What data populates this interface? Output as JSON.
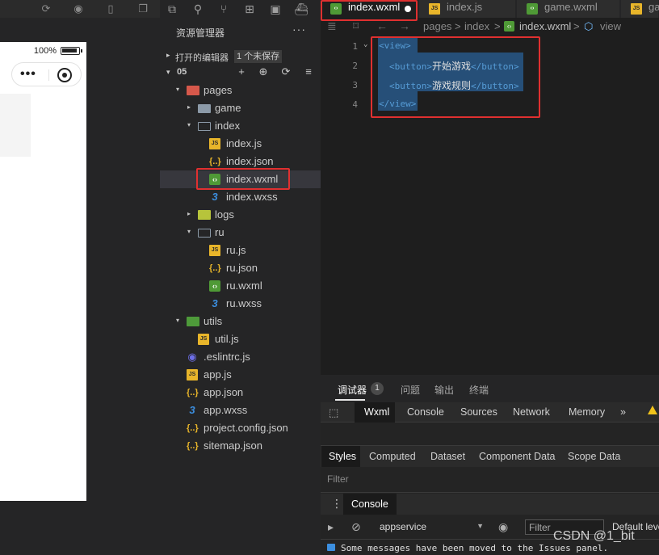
{
  "simulator": {
    "battery_percent": "100%"
  },
  "explorer": {
    "title": "资源管理器",
    "more": "···",
    "open_editors": {
      "label": "打开的编辑器",
      "unsaved_badge": "1 个未保存"
    },
    "project": {
      "name": "05"
    },
    "tree": [
      {
        "name": "pages",
        "kind": "folder-pages",
        "depth": 1,
        "arrow": "▾"
      },
      {
        "name": "game",
        "kind": "folder",
        "depth": 2,
        "arrow": "▸"
      },
      {
        "name": "index",
        "kind": "folder-open",
        "depth": 2,
        "arrow": "▾"
      },
      {
        "name": "index.js",
        "kind": "js",
        "depth": 3
      },
      {
        "name": "index.json",
        "kind": "json",
        "depth": 3
      },
      {
        "name": "index.wxml",
        "kind": "wxml",
        "depth": 3,
        "selected": true
      },
      {
        "name": "index.wxss",
        "kind": "wxss",
        "depth": 3
      },
      {
        "name": "logs",
        "kind": "folder-logs",
        "depth": 2,
        "arrow": "▸"
      },
      {
        "name": "ru",
        "kind": "folder-open",
        "depth": 2,
        "arrow": "▾"
      },
      {
        "name": "ru.js",
        "kind": "js",
        "depth": 3
      },
      {
        "name": "ru.json",
        "kind": "json",
        "depth": 3
      },
      {
        "name": "ru.wxml",
        "kind": "wxml",
        "depth": 3
      },
      {
        "name": "ru.wxss",
        "kind": "wxss",
        "depth": 3
      },
      {
        "name": "utils",
        "kind": "folder-utils",
        "depth": 1,
        "arrow": "▾"
      },
      {
        "name": "util.js",
        "kind": "js",
        "depth": 2
      },
      {
        "name": ".eslintrc.js",
        "kind": "eslint",
        "depth": 1
      },
      {
        "name": "app.js",
        "kind": "js",
        "depth": 1
      },
      {
        "name": "app.json",
        "kind": "json",
        "depth": 1
      },
      {
        "name": "app.wxss",
        "kind": "wxss",
        "depth": 1
      },
      {
        "name": "project.config.json",
        "kind": "json",
        "depth": 1
      },
      {
        "name": "sitemap.json",
        "kind": "json",
        "depth": 1
      }
    ]
  },
  "editor": {
    "tabs": [
      {
        "name": "index.wxml",
        "kind": "wxml",
        "active": true,
        "dirty": true
      },
      {
        "name": "index.js",
        "kind": "js"
      },
      {
        "name": "game.wxml",
        "kind": "wxml"
      },
      {
        "name": "gar",
        "kind": "js"
      }
    ],
    "breadcrumbs": {
      "pages": "pages",
      "sep": ">",
      "index": "index",
      "file": "index.wxml",
      "node": "view"
    },
    "lines": [
      {
        "num": "1",
        "open": "<view>",
        "text": "",
        "close": ""
      },
      {
        "num": "2",
        "open": "<button>",
        "text": "开始游戏",
        "close": "</button>"
      },
      {
        "num": "3",
        "open": "<button>",
        "text": "游戏规则",
        "close": "</button>"
      },
      {
        "num": "4",
        "open": "</view>",
        "text": "",
        "close": ""
      }
    ]
  },
  "devtools": {
    "top_tabs": [
      {
        "label": "调试器",
        "active": true,
        "badge": "1"
      },
      {
        "label": "问题"
      },
      {
        "label": "输出"
      },
      {
        "label": "终端"
      }
    ],
    "panel_tabs": [
      {
        "label": "Wxml",
        "active": true
      },
      {
        "label": "Console"
      },
      {
        "label": "Sources"
      },
      {
        "label": "Network"
      },
      {
        "label": "Memory"
      },
      {
        "label": "»"
      }
    ],
    "style_tabs": [
      {
        "label": "Styles",
        "active": true
      },
      {
        "label": "Computed"
      },
      {
        "label": "Dataset"
      },
      {
        "label": "Component Data"
      },
      {
        "label": "Scope Data"
      }
    ],
    "filter_placeholder": "Filter",
    "console_tab": "Console",
    "context": "appservice",
    "console_filter": "Filter",
    "default_levels": "Default levels",
    "message": "Some messages have been moved to the Issues panel."
  },
  "watermark": "CSDN @1_bit",
  "colors": {
    "highlight": "#e03030",
    "selection": "#264f78",
    "tag": "#569cd6"
  }
}
